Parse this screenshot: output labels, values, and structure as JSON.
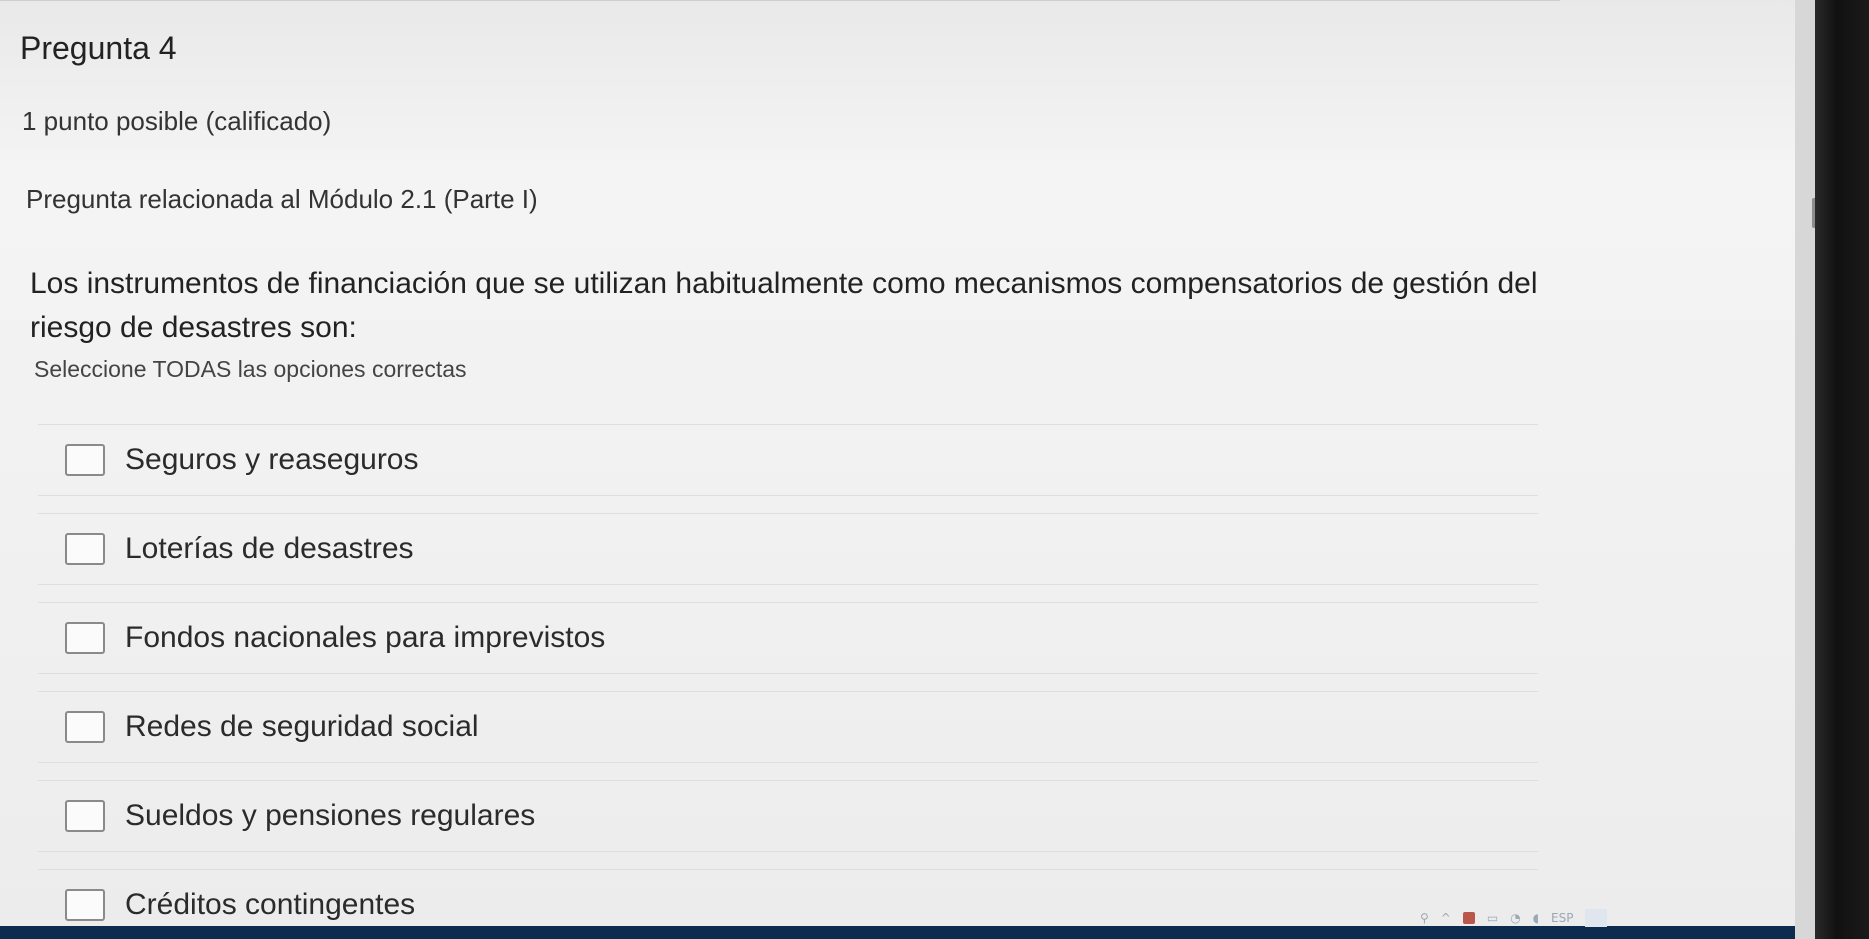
{
  "problem": {
    "title": "Pregunta 4",
    "points": "1 punto posible (calificado)",
    "related": "Pregunta relacionada al Módulo 2.1 (Parte I)",
    "prompt": "Los instrumentos de financiación que se utilizan habitualmente como mecanismos compensatorios de gestión del riesgo de desastres son:",
    "instruction": "Seleccione TODAS las opciones correctas"
  },
  "choices": [
    {
      "label": "Seguros y reaseguros",
      "checked": false
    },
    {
      "label": "Loterías de desastres",
      "checked": false
    },
    {
      "label": "Fondos nacionales para imprevistos",
      "checked": false
    },
    {
      "label": "Redes de seguridad social",
      "checked": false
    },
    {
      "label": "Sueldos y pensiones regulares",
      "checked": false
    },
    {
      "label": "Créditos contingentes",
      "checked": false
    }
  ],
  "taskbar": {
    "language": "ESP"
  }
}
